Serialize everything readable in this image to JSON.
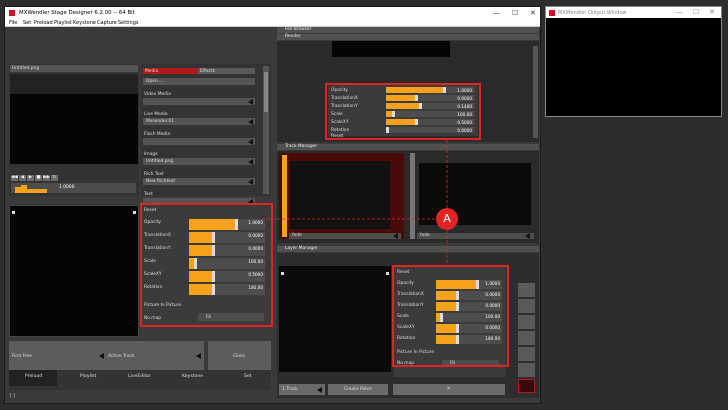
{
  "main_window": {
    "title": "MXWendler Stage Designer 6.2.00 -- 64 Bit",
    "menu": [
      "File",
      "Set",
      "Preload",
      "Playlist",
      "Keystone",
      "Capture",
      "Settings"
    ]
  },
  "output_window": {
    "title": "MXWendler Output Window"
  },
  "left": {
    "preview_title": "Untitled.png",
    "timeline_value": "1.0000",
    "transport_icons": [
      "◀◀",
      "◀",
      "▶",
      "■",
      "▶▶",
      "↻"
    ]
  },
  "media_list": {
    "tabs": {
      "media": "Media",
      "effects": "Effects"
    },
    "open_label": "Open ...",
    "sections": [
      {
        "title": "Video Media",
        "value": ""
      },
      {
        "title": "Live Media",
        "value": "Mxsender.01"
      },
      {
        "title": "Flash Media",
        "value": ""
      },
      {
        "title": "Image",
        "value": "Untitled.png"
      },
      {
        "title": "Rich Text",
        "value": "New Richtext"
      },
      {
        "title": "Text",
        "value": ""
      }
    ]
  },
  "props_left": {
    "reset": "Reset",
    "rows": [
      {
        "label": "Opacity",
        "value": "1.0000",
        "fill": 1.0
      },
      {
        "label": "TranslationX",
        "value": "0.0000",
        "fill": 0.5
      },
      {
        "label": "TranslationY",
        "value": "0.0000",
        "fill": 0.5
      },
      {
        "label": "Scale",
        "value": "100.00",
        "fill": 0.1
      },
      {
        "label": "ScaleXY",
        "value": "0.5000",
        "fill": 0.5
      },
      {
        "label": "Rotation",
        "value": "180.00",
        "fill": 0.5
      }
    ],
    "pip": "Picture In Picture",
    "nomap": "No.map",
    "fit": "Fit"
  },
  "left_bottom": {
    "first_free": "First Free",
    "active_track": "Active Track",
    "close": "Close"
  },
  "tabs": [
    "Preload",
    "Playlist",
    "LiveEditor",
    "Keystone",
    "Set"
  ],
  "right": {
    "file_browser": "File Browser",
    "render": "Render",
    "track_manager": "Track Manager",
    "layer_manager": "Layer Manager",
    "fade1": "fade",
    "fade2": "fade",
    "btn_track": "1 Track",
    "btn_create_patch": "Create Patch",
    "btn_x": "X"
  },
  "props_render": {
    "rows": [
      {
        "label": "Opacity",
        "value": "1.0000",
        "fill": 1.0
      },
      {
        "label": "TranslationX",
        "value": "0.0000",
        "fill": 0.5
      },
      {
        "label": "TranslationY",
        "value": "0.1400",
        "fill": 0.57
      },
      {
        "label": "Scale",
        "value": "100.00",
        "fill": 0.1
      },
      {
        "label": "ScaleXY",
        "value": "0.5000",
        "fill": 0.5
      },
      {
        "label": "Rotation",
        "value": "0.0000",
        "fill": 0.0
      }
    ],
    "reset": "Reset"
  },
  "props_layer": {
    "reset": "Reset",
    "rows": [
      {
        "label": "Opacity",
        "value": "1.0000",
        "fill": 1.0
      },
      {
        "label": "TranslationX",
        "value": "0.0000",
        "fill": 0.5
      },
      {
        "label": "TranslationY",
        "value": "0.0000",
        "fill": 0.5
      },
      {
        "label": "Scale",
        "value": "100.00",
        "fill": 0.1
      },
      {
        "label": "ScaleXY",
        "value": "0.0000",
        "fill": 0.5
      },
      {
        "label": "Rotation",
        "value": "180.00",
        "fill": 0.5
      }
    ],
    "pip": "Picture In Picture",
    "nomap": "No.map",
    "fit": "Fit"
  },
  "callout": "A",
  "colors": {
    "accent": "#f6a21a",
    "annotation": "#e02424",
    "track_red": "#4a0a0a"
  }
}
